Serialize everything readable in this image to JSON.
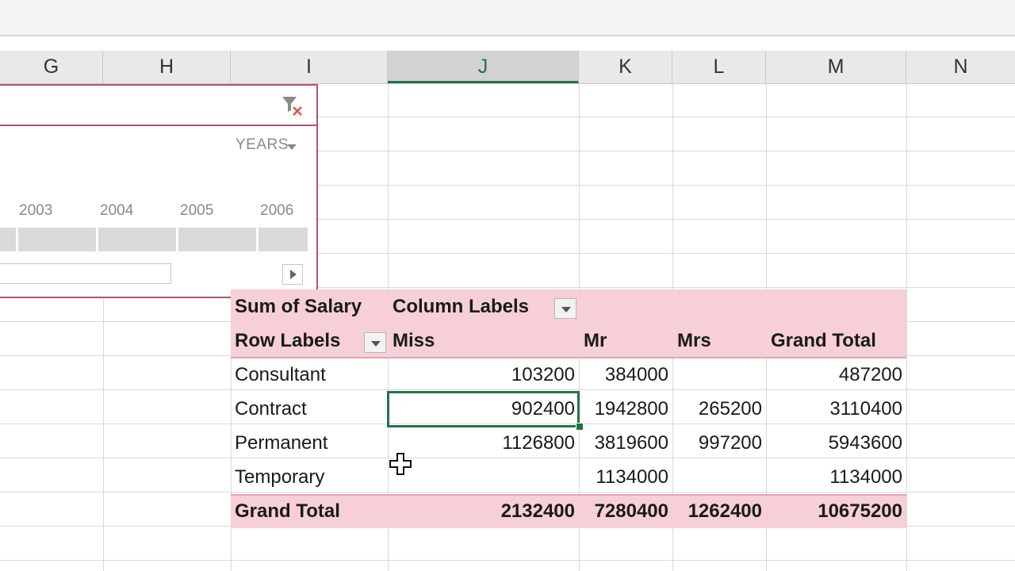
{
  "columns": [
    "G",
    "H",
    "I",
    "J",
    "K",
    "L",
    "M",
    "N"
  ],
  "selected_column": "J",
  "timeline": {
    "period_label": "YEARS",
    "years": [
      "2003",
      "2004",
      "2005",
      "2006"
    ],
    "icons": {
      "clear_filter": "clear-filter-icon",
      "scroll_right": "scroll-right-icon"
    }
  },
  "pivot": {
    "value_field": "Sum of Salary",
    "column_labels": "Column Labels",
    "row_labels": "Row Labels",
    "column_headers": [
      "Miss",
      "Mr",
      "Mrs",
      "Grand Total"
    ],
    "rows": [
      {
        "label": "Consultant",
        "values": [
          "103200",
          "384000",
          "",
          "487200"
        ]
      },
      {
        "label": "Contract",
        "values": [
          "902400",
          "1942800",
          "265200",
          "3110400"
        ]
      },
      {
        "label": "Permanent",
        "values": [
          "1126800",
          "3819600",
          "997200",
          "5943600"
        ]
      },
      {
        "label": "Temporary",
        "values": [
          "",
          "1134000",
          "",
          "1134000"
        ]
      }
    ],
    "grand_total": {
      "label": "Grand Total",
      "values": [
        "2132400",
        "7280400",
        "1262400",
        "10675200"
      ]
    }
  },
  "colors": {
    "accent_green": "#217346",
    "pivot_header_fill": "#f6cfd7",
    "timeline_border": "#b5536b"
  }
}
